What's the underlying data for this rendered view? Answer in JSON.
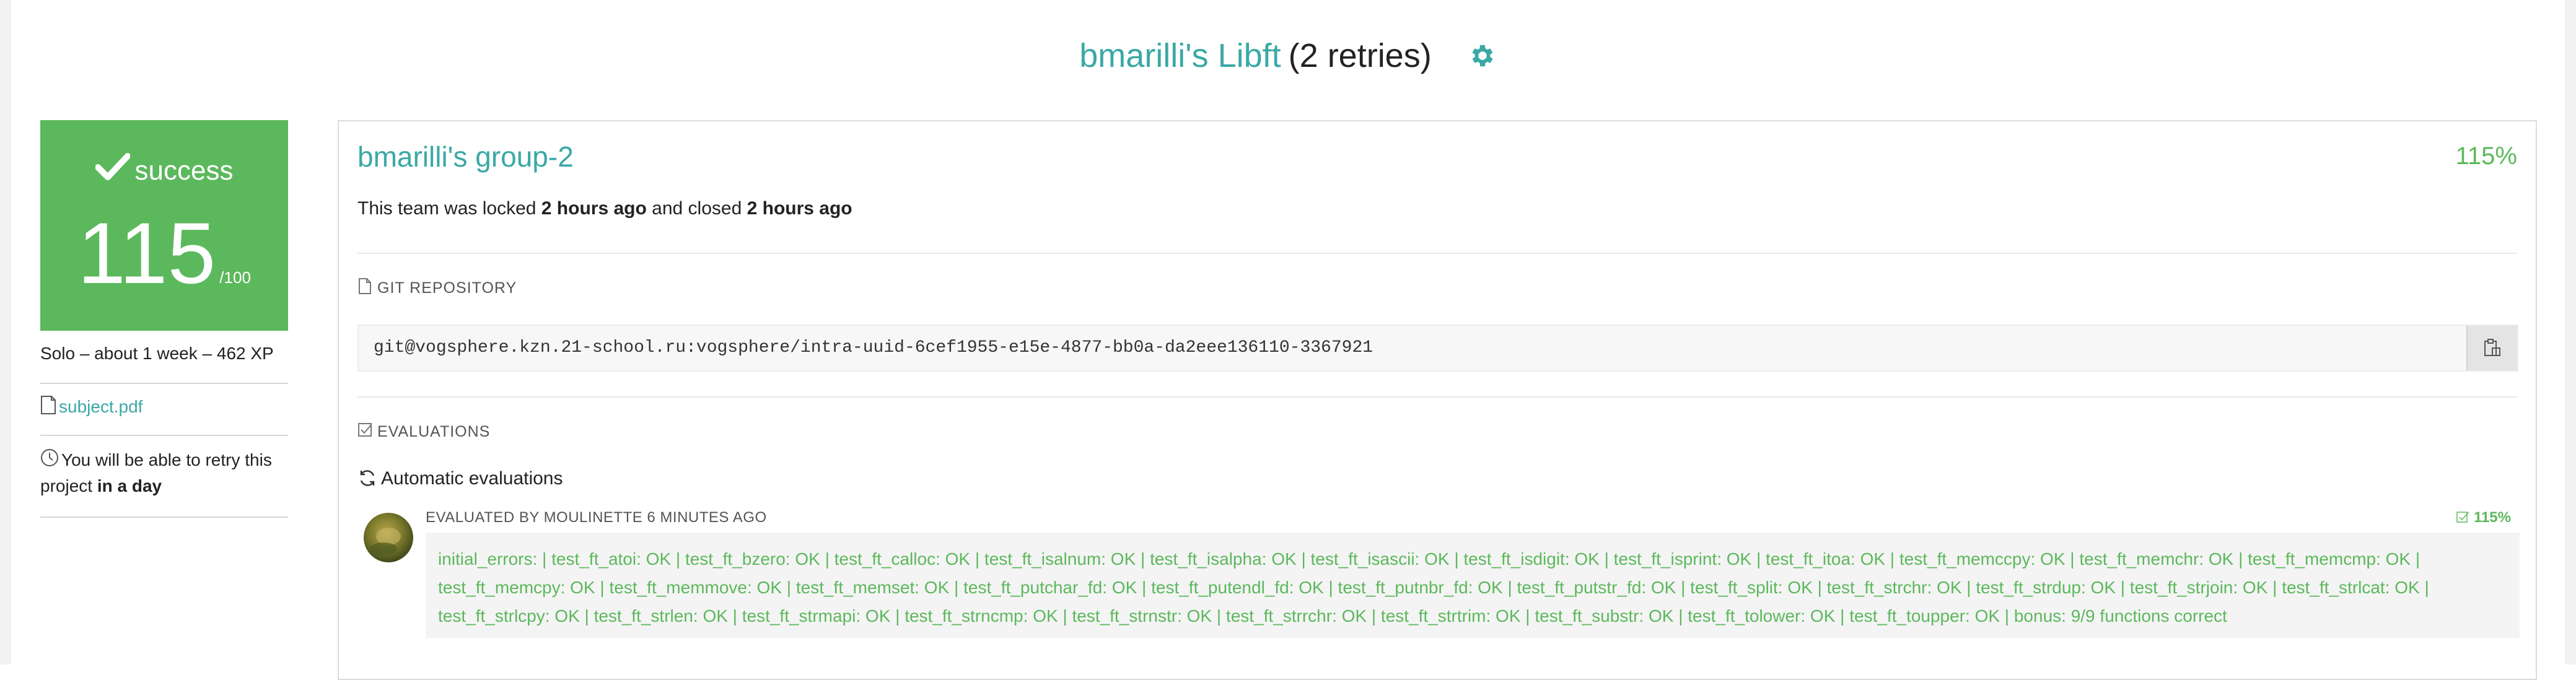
{
  "header": {
    "project_owner_title": "bmarilli's Libft",
    "retries": "(2 retries)",
    "settings_icon": "gear-icon"
  },
  "status": {
    "label": "success",
    "score": "115",
    "score_max": "/100",
    "meta": "Solo – about 1 week – 462 XP",
    "subject_link": "subject.pdf",
    "retry_text_prefix": "You will be able to retry this project ",
    "retry_text_bold": "in a day",
    "color": "#5cb85c"
  },
  "team": {
    "name": "bmarilli's group-2",
    "percentage": "115%",
    "lock_prefix": "This team was locked ",
    "locked_when": "2 hours ago",
    "lock_middle": " and closed ",
    "closed_when": "2 hours ago"
  },
  "repository": {
    "section_label": "GIT REPOSITORY",
    "url": "git@vogsphere.kzn.21-school.ru:vogsphere/intra-uuid-6cef1955-e15e-4877-bb0a-da2eee136110-3367921",
    "copy_icon": "clipboard-icon"
  },
  "evaluations": {
    "section_label": "EVALUATIONS",
    "automatic_label": "Automatic evaluations",
    "evaluator_line": "EVALUATED BY MOULINETTE 6 MINUTES AGO",
    "percentage": "115%",
    "result_text": "initial_errors: | test_ft_atoi: OK | test_ft_bzero: OK | test_ft_calloc: OK | test_ft_isalnum: OK | test_ft_isalpha: OK | test_ft_isascii: OK | test_ft_isdigit: OK | test_ft_isprint: OK | test_ft_itoa: OK | test_ft_memccpy: OK | test_ft_memchr: OK | test_ft_memcmp: OK | test_ft_memcpy: OK | test_ft_memmove: OK | test_ft_memset: OK | test_ft_putchar_fd: OK | test_ft_putendl_fd: OK | test_ft_putnbr_fd: OK | test_ft_putstr_fd: OK | test_ft_split: OK | test_ft_strchr: OK | test_ft_strdup: OK | test_ft_strjoin: OK | test_ft_strlcat: OK | test_ft_strlcpy: OK | test_ft_strlen: OK | test_ft_strmapi: OK | test_ft_strncmp: OK | test_ft_strnstr: OK | test_ft_strrchr: OK | test_ft_strtrim: OK | test_ft_substr: OK | test_ft_tolower: OK | test_ft_toupper: OK | bonus: 9/9 functions correct"
  },
  "colors": {
    "accent": "#3aa9a5",
    "success": "#5cb85c"
  }
}
